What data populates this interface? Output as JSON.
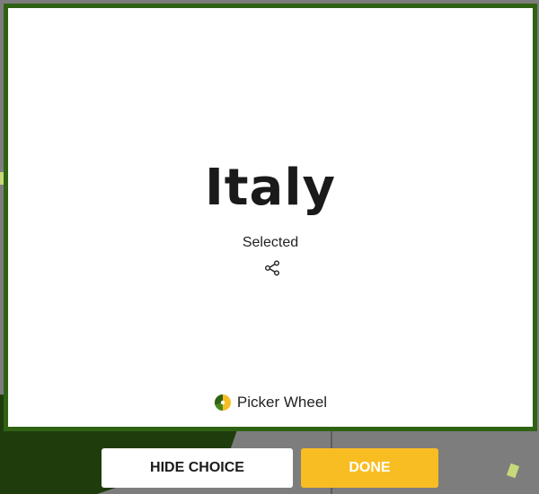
{
  "result": {
    "title": "Italy",
    "subtitle": "Selected"
  },
  "share": {
    "icon": "share-icon"
  },
  "brand": {
    "name": "Picker Wheel",
    "logo_icon": "picker-wheel-logo-icon"
  },
  "actions": {
    "hide_choice_label": "HIDE CHOICE",
    "done_label": "DONE"
  },
  "colors": {
    "modal_border": "#2f6212",
    "done_button": "#f9bd24",
    "backdrop": "#7d7d7d",
    "wheel_green": "#1f3d0c"
  }
}
